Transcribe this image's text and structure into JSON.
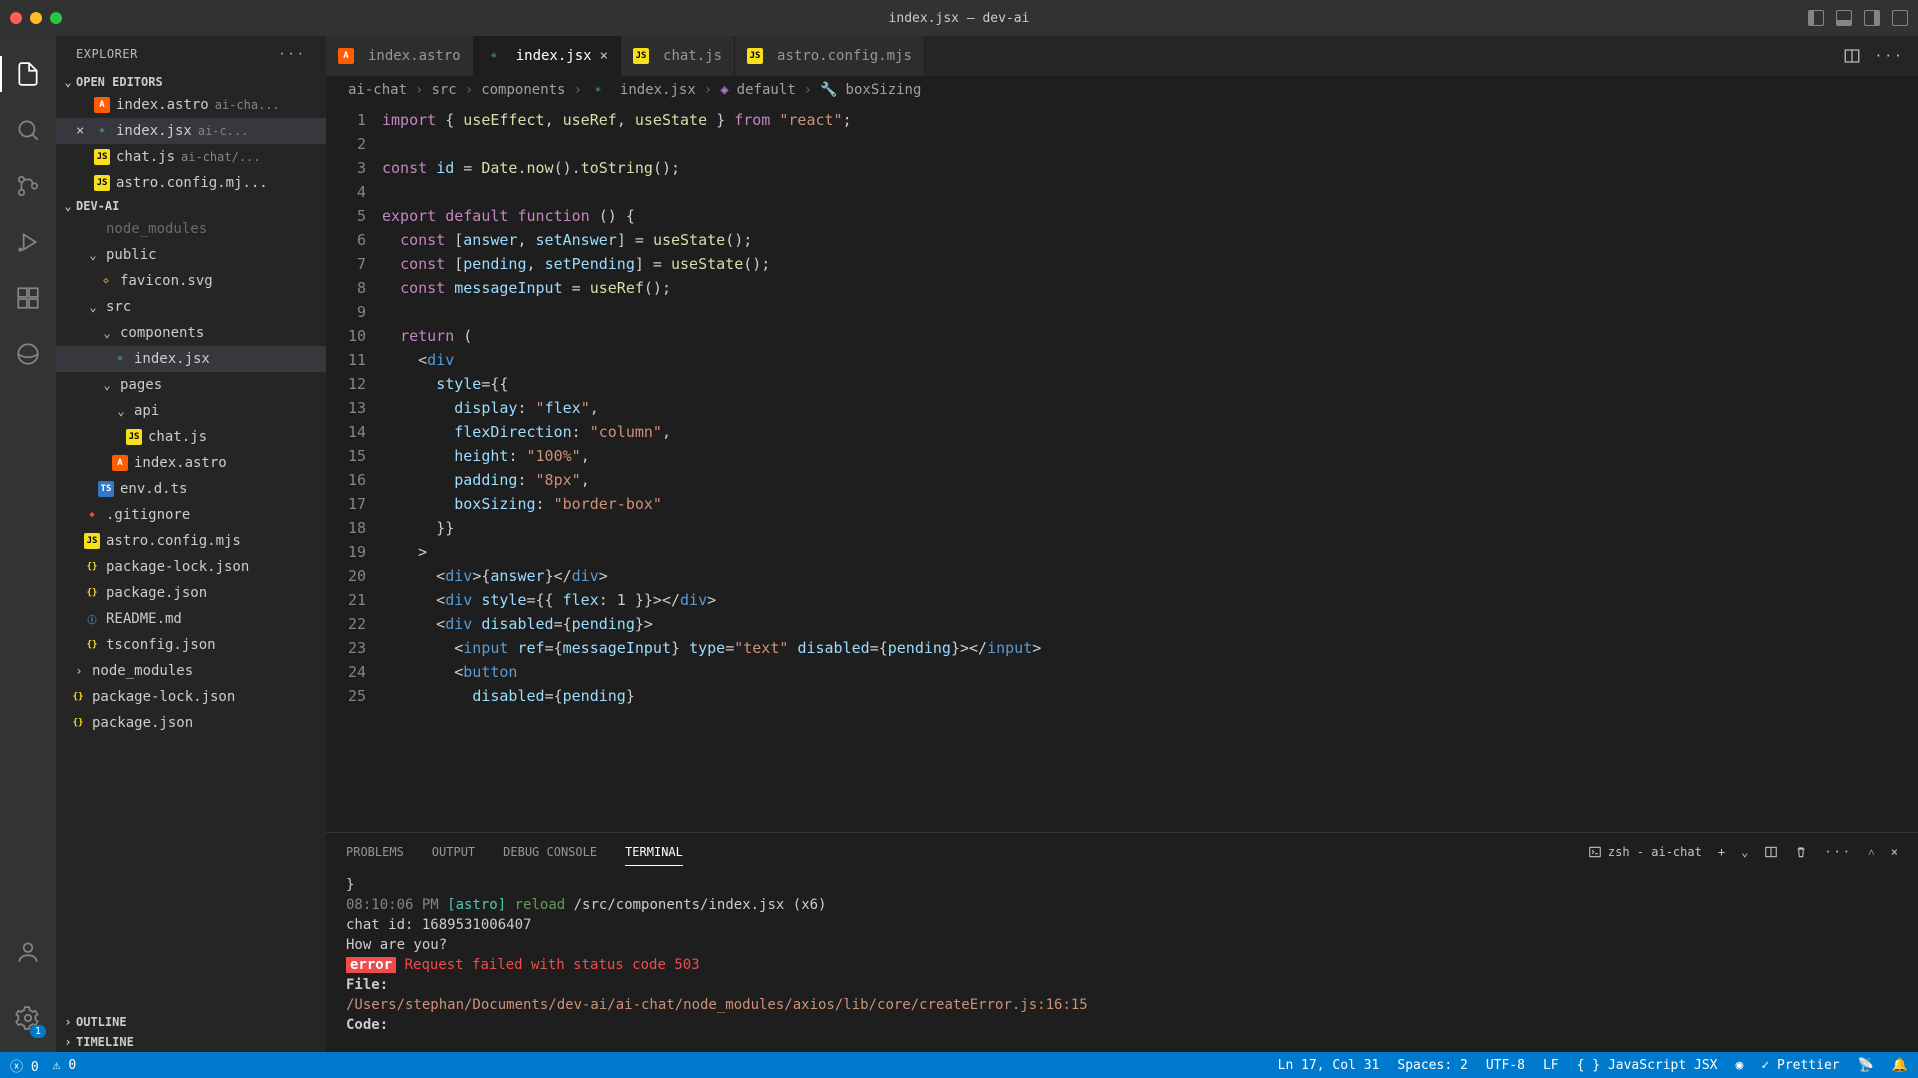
{
  "window": {
    "title": "index.jsx — dev-ai"
  },
  "explorer": {
    "title": "EXPLORER",
    "openEditors": {
      "title": "OPEN EDITORS",
      "items": [
        {
          "name": "index.astro",
          "desc": "ai-cha..."
        },
        {
          "name": "index.jsx",
          "desc": "ai-c...",
          "active": true,
          "close": true
        },
        {
          "name": "chat.js",
          "desc": "ai-chat/..."
        },
        {
          "name": "astro.config.mj...",
          "desc": ""
        }
      ]
    },
    "project": {
      "title": "DEV-AI",
      "tree": [
        {
          "indent": 1,
          "chev": "",
          "label": "node_modules",
          "dim": true
        },
        {
          "indent": 1,
          "chev": "⌄",
          "label": "public"
        },
        {
          "indent": 2,
          "icon": "svg",
          "label": "favicon.svg"
        },
        {
          "indent": 1,
          "chev": "⌄",
          "label": "src"
        },
        {
          "indent": 2,
          "chev": "⌄",
          "label": "components"
        },
        {
          "indent": 3,
          "icon": "react",
          "label": "index.jsx",
          "active": true
        },
        {
          "indent": 2,
          "chev": "⌄",
          "label": "pages"
        },
        {
          "indent": 3,
          "chev": "⌄",
          "label": "api"
        },
        {
          "indent": 4,
          "icon": "js",
          "label": "chat.js"
        },
        {
          "indent": 3,
          "icon": "astro",
          "label": "index.astro"
        },
        {
          "indent": 2,
          "icon": "ts",
          "label": "env.d.ts"
        },
        {
          "indent": 1,
          "icon": "git",
          "label": ".gitignore"
        },
        {
          "indent": 1,
          "icon": "js",
          "label": "astro.config.mjs"
        },
        {
          "indent": 1,
          "icon": "json",
          "label": "package-lock.json"
        },
        {
          "indent": 1,
          "icon": "json",
          "label": "package.json"
        },
        {
          "indent": 1,
          "icon": "md",
          "label": "README.md"
        },
        {
          "indent": 1,
          "icon": "json",
          "label": "tsconfig.json"
        },
        {
          "indent": 0,
          "chev": "›",
          "label": "node_modules"
        },
        {
          "indent": 0,
          "icon": "json",
          "label": "package-lock.json"
        },
        {
          "indent": 0,
          "icon": "json",
          "label": "package.json"
        }
      ]
    },
    "outline": "OUTLINE",
    "timeline": "TIMELINE"
  },
  "tabs": [
    {
      "label": "index.astro",
      "icon": "astro"
    },
    {
      "label": "index.jsx",
      "icon": "react",
      "active": true,
      "close": true
    },
    {
      "label": "chat.js",
      "icon": "js"
    },
    {
      "label": "astro.config.mjs",
      "icon": "js"
    }
  ],
  "breadcrumb": [
    "ai-chat",
    "src",
    "components",
    "index.jsx",
    "default",
    "boxSizing"
  ],
  "code": {
    "lines": [
      "import { useEffect, useRef, useState } from \"react\";",
      "",
      "const id = Date.now().toString();",
      "",
      "export default function () {",
      "  const [answer, setAnswer] = useState();",
      "  const [pending, setPending] = useState();",
      "  const messageInput = useRef();",
      "",
      "  return (",
      "    <div",
      "      style={{",
      "        display: \"flex\",",
      "        flexDirection: \"column\",",
      "        height: \"100%\",",
      "        padding: \"8px\",",
      "        boxSizing: \"border-box\"",
      "      }}",
      "    >",
      "      <div>{answer}</div>",
      "      <div style={{ flex: 1 }}></div>",
      "      <div disabled={pending}>",
      "        <input ref={messageInput} type=\"text\" disabled={pending}></input>",
      "        <button",
      "          disabled={pending}"
    ]
  },
  "panel": {
    "tabs": [
      "PROBLEMS",
      "OUTPUT",
      "DEBUG CONSOLE",
      "TERMINAL"
    ],
    "activeTab": 3,
    "shell": "zsh - ai-chat",
    "lines": {
      "brace": "  }",
      "ts": "08:10:06 PM",
      "astro": "[astro]",
      "reload": "reload",
      "path": "/src/components/index.jsx (x6)",
      "chatid": "chat id: 1689531006407",
      "how": "How are you?",
      "err": "error",
      "errmsg": "Request failed with status code 503",
      "filelabel": "File:",
      "filepath": "/Users/stephan/Documents/dev-ai/ai-chat/node_modules/axios/lib/core/createError.js:16:15",
      "codelabel": "Code:"
    }
  },
  "status": {
    "errors": "0",
    "warnings": "0",
    "position": "Ln 17, Col 31",
    "spaces": "Spaces: 2",
    "encoding": "UTF-8",
    "eol": "LF",
    "lang": "JavaScript JSX",
    "prettier": "Prettier"
  }
}
